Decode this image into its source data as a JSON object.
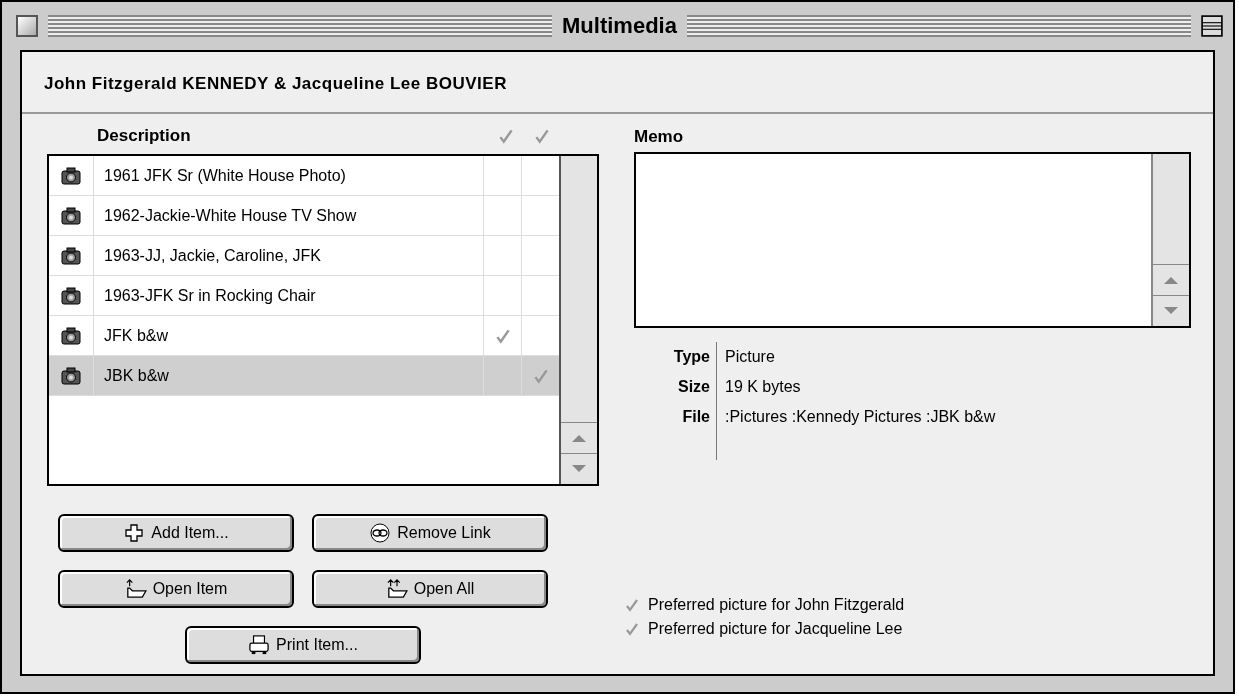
{
  "window": {
    "title": "Multimedia"
  },
  "heading": "John Fitzgerald KENNEDY & Jacqueline Lee BOUVIER",
  "list": {
    "column_header": "Description",
    "rows": [
      {
        "description": "1961 JFK Sr (White House Photo)",
        "preferred_first": false,
        "preferred_second": false,
        "selected": false
      },
      {
        "description": "1962-Jackie-White House TV Show",
        "preferred_first": false,
        "preferred_second": false,
        "selected": false
      },
      {
        "description": "1963-JJ, Jackie, Caroline, JFK",
        "preferred_first": false,
        "preferred_second": false,
        "selected": false
      },
      {
        "description": "1963-JFK Sr in Rocking Chair",
        "preferred_first": false,
        "preferred_second": false,
        "selected": false
      },
      {
        "description": "JFK b&w",
        "preferred_first": true,
        "preferred_second": false,
        "selected": false
      },
      {
        "description": "JBK b&w",
        "preferred_first": false,
        "preferred_second": true,
        "selected": true
      }
    ]
  },
  "buttons": [
    {
      "kind": "add",
      "label": "Add Item..."
    },
    {
      "kind": "remove",
      "label": "Remove Link"
    },
    {
      "kind": "open",
      "label": "Open Item"
    },
    {
      "kind": "open_all",
      "label": "Open All"
    },
    {
      "kind": "print",
      "label": "Print Item..."
    }
  ],
  "memo": {
    "label": "Memo"
  },
  "info": [
    {
      "label": "Type",
      "value": "Picture"
    },
    {
      "label": "Size",
      "value": "19 K bytes"
    },
    {
      "label": "File",
      "value": ":Pictures :Kennedy Pictures :JBK b&w"
    }
  ],
  "legend": [
    "Preferred picture for John Fitzgerald",
    "Preferred picture for Jacqueline Lee"
  ]
}
